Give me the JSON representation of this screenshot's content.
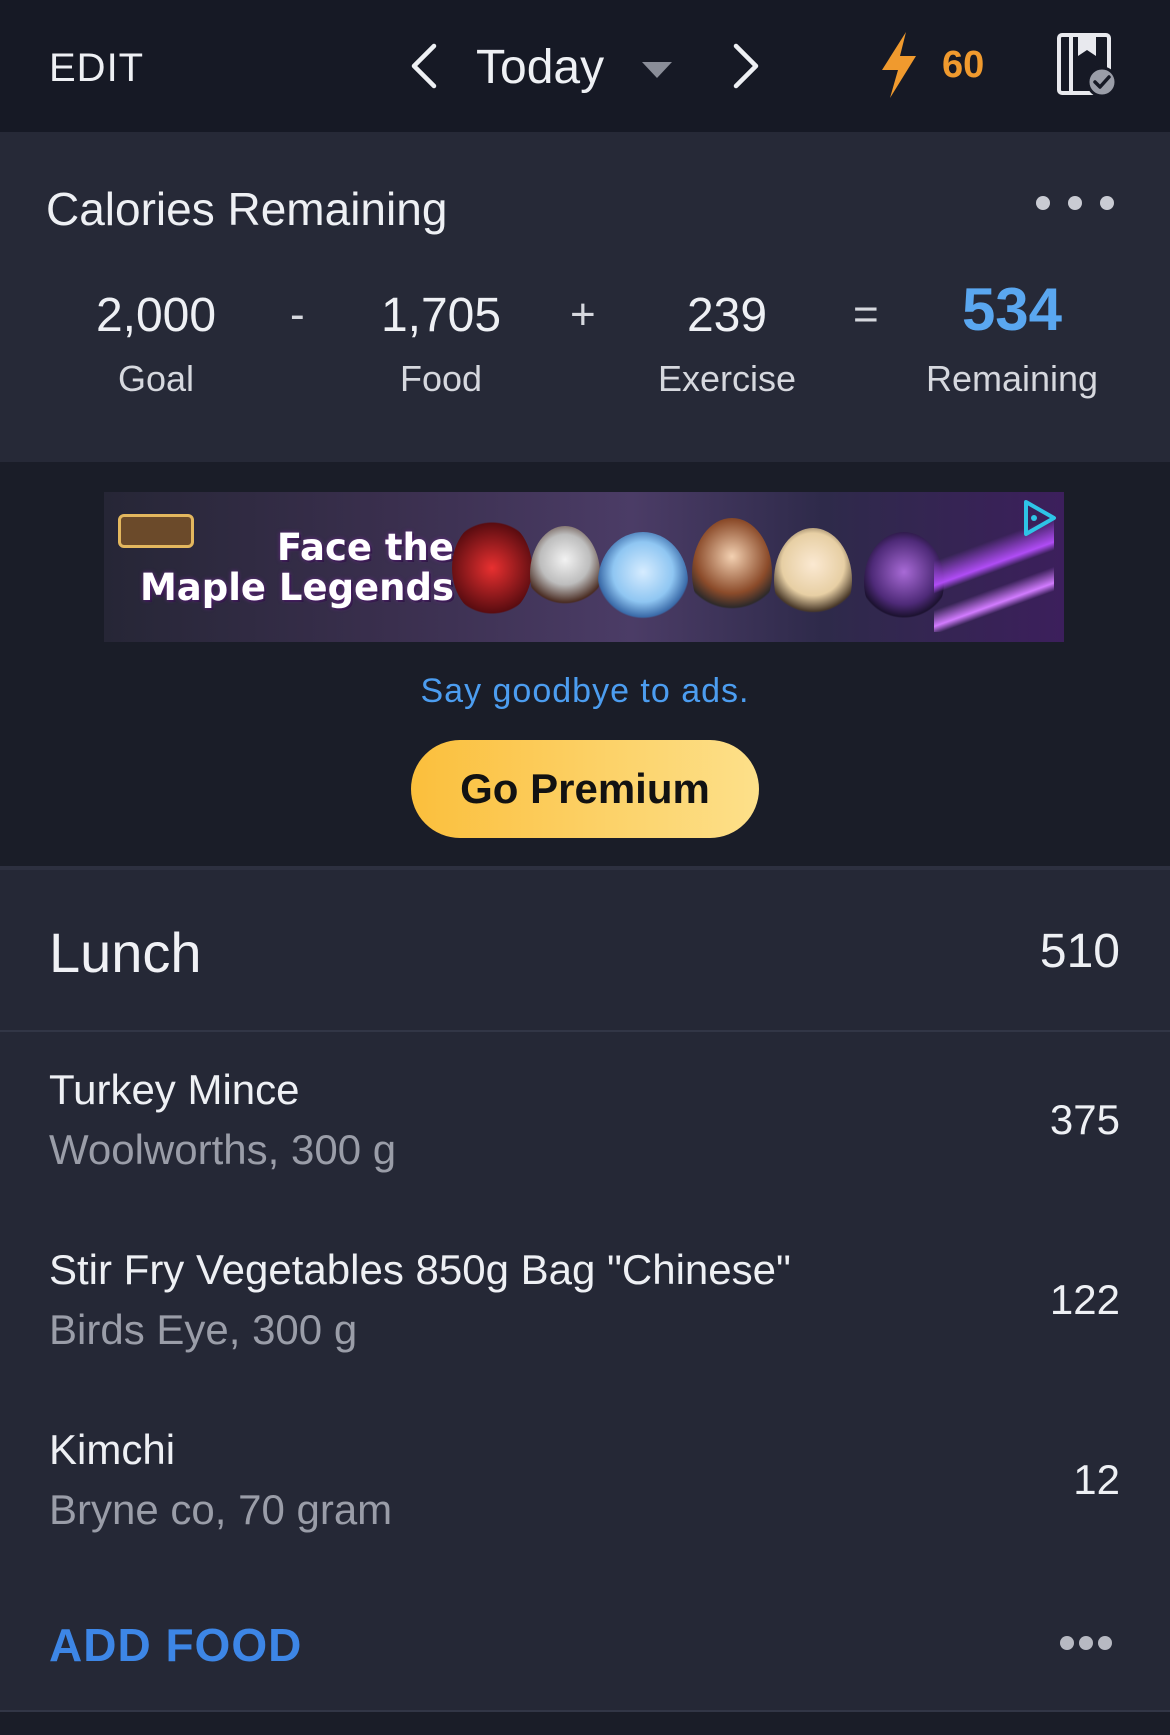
{
  "header": {
    "edit_label": "EDIT",
    "date_label": "Today",
    "streak_count": "60",
    "streak_color": "#f09a2e"
  },
  "calories": {
    "title": "Calories Remaining",
    "goal_value": "2,000",
    "goal_label": "Goal",
    "minus_sign": "-",
    "food_value": "1,705",
    "food_label": "Food",
    "plus_sign": "+",
    "exercise_value": "239",
    "exercise_label": "Exercise",
    "equals_sign": "=",
    "remaining_value": "534",
    "remaining_label": "Remaining",
    "remaining_color": "#5aa7f0"
  },
  "ad": {
    "headline_line1": "Face the",
    "headline_line2": "Maple Legends",
    "cta_text": "Say goodbye to ads.",
    "premium_label": "Go Premium"
  },
  "meal": {
    "title": "Lunch",
    "total": "510",
    "items": [
      {
        "name": "Turkey Mince",
        "desc": "Woolworths, 300 g",
        "calories": "375"
      },
      {
        "name": "Stir Fry Vegetables 850g Bag \"Chinese\"",
        "desc": "Birds Eye, 300 g",
        "calories": "122"
      },
      {
        "name": "Kimchi",
        "desc": "Bryne co, 70 gram",
        "calories": "12"
      }
    ],
    "add_food_label": "ADD FOOD"
  },
  "icons": [
    "chevron-left-icon",
    "caret-down-icon",
    "chevron-right-icon",
    "lightning-icon",
    "diary-check-icon",
    "more-horizontal-icon",
    "ad-choices-icon"
  ]
}
